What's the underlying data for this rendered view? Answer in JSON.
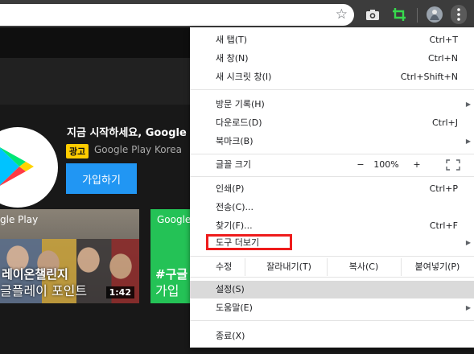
{
  "toolbar": {
    "bookmark_icon": "star-icon",
    "extension_icons": [
      "camera-icon",
      "screen-capture-icon",
      "profile-avatar-icon"
    ],
    "menu_icon": "kebab-menu-icon"
  },
  "page": {
    "promo_title": "지금 시작하세요, Google",
    "ad_badge": "광고",
    "publisher": "Google Play Korea",
    "signup_button": "가입하기",
    "thumb1": {
      "brand": "gle Play",
      "title_line1": "레이온챌린지",
      "title_line2": "글플레이 포인트",
      "duration": "1:42"
    },
    "thumb2": {
      "brand": "Google",
      "title_line1": "#구글",
      "title_line2": "가입"
    }
  },
  "menu": {
    "new_tab": {
      "label": "새 탭(T)",
      "shortcut": "Ctrl+T"
    },
    "new_window": {
      "label": "새 창(N)",
      "shortcut": "Ctrl+N"
    },
    "new_incognito": {
      "label": "새 시크릿 창(I)",
      "shortcut": "Ctrl+Shift+N"
    },
    "history": {
      "label": "방문 기록(H)"
    },
    "downloads": {
      "label": "다운로드(D)",
      "shortcut": "Ctrl+J"
    },
    "bookmarks": {
      "label": "북마크(B)"
    },
    "zoom": {
      "label": "글꼴 크기",
      "minus": "−",
      "value": "100%",
      "plus": "+"
    },
    "print": {
      "label": "인쇄(P)",
      "shortcut": "Ctrl+P"
    },
    "cast": {
      "label": "전송(C)..."
    },
    "find": {
      "label": "찾기(F)...",
      "shortcut": "Ctrl+F"
    },
    "more_tools": {
      "label": "도구 더보기"
    },
    "edit": {
      "label": "수정",
      "cut": "잘라내기(T)",
      "copy": "복사(C)",
      "paste": "붙여넣기(P)"
    },
    "settings": {
      "label": "설정(S)"
    },
    "help": {
      "label": "도움말(E)"
    },
    "exit": {
      "label": "종료(X)"
    }
  },
  "colors": {
    "menu_highlight": "#dadada",
    "annotation_box": "#ee1c1c",
    "signup_blue": "#2196f3",
    "ad_yellow": "#ffcc00"
  }
}
